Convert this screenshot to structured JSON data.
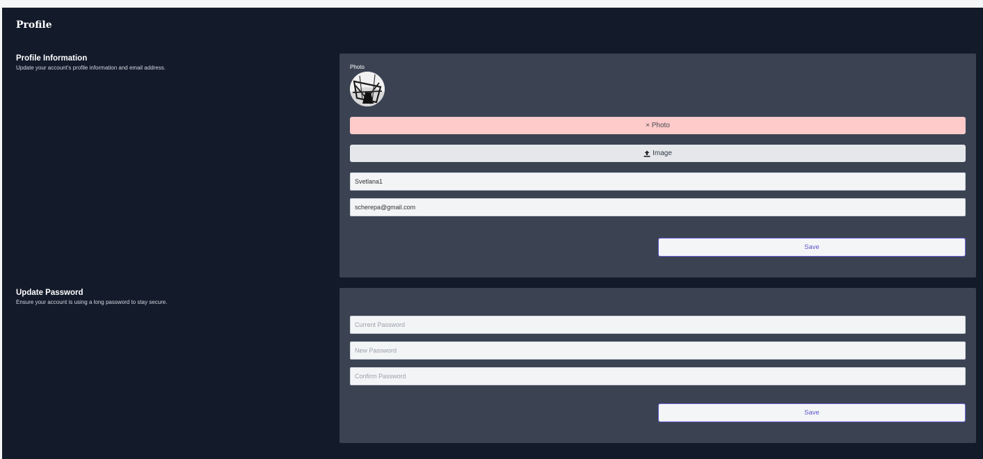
{
  "page": {
    "title": "Profile"
  },
  "profile_section": {
    "title": "Profile Information",
    "description": "Update your account's profile information and email address.",
    "photo_label": "Photo",
    "remove_photo_label": "× Photo",
    "upload_image_label": "Image",
    "name_value": "Svetlana1",
    "email_value": "scherepa@gmail.com",
    "save_label": "Save"
  },
  "password_section": {
    "title": "Update Password",
    "description": "Ensure your account is using a long password to stay secure.",
    "current_placeholder": "Current Password",
    "new_placeholder": "New Password",
    "confirm_placeholder": "Confirm Password",
    "save_label": "Save"
  },
  "icons": {
    "upload": "upload-icon",
    "avatar": "avatar-photo"
  },
  "colors": {
    "page_background": "#131a2a",
    "card_background": "#3b4353",
    "remove_button": "#fecaca",
    "upload_button": "#e5e7eb",
    "save_border": "#6c63d6"
  }
}
